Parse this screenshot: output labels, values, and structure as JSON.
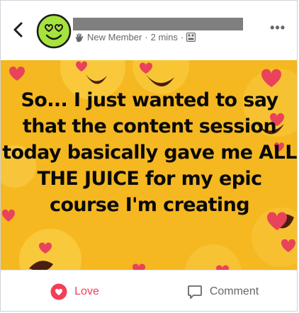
{
  "author": {
    "badge": "New Member",
    "time": "2 mins",
    "separator": "·"
  },
  "post": {
    "text": "So... I just wanted to say that the content session today basically gave me ALL THE JUICE for my epic course I'm creating",
    "background_color": "#f5b820"
  },
  "actions": {
    "love_label": "Love",
    "comment_label": "Comment"
  },
  "colors": {
    "love": "#f33e58",
    "meta": "#65676b",
    "avatar": "#a6e33c"
  },
  "icons": {
    "back": "chevron-left-icon",
    "badge": "wave-hand-icon",
    "audience": "group-icon",
    "more": "more-horizontal-icon",
    "love": "heart-icon",
    "comment": "comment-bubble-icon"
  }
}
